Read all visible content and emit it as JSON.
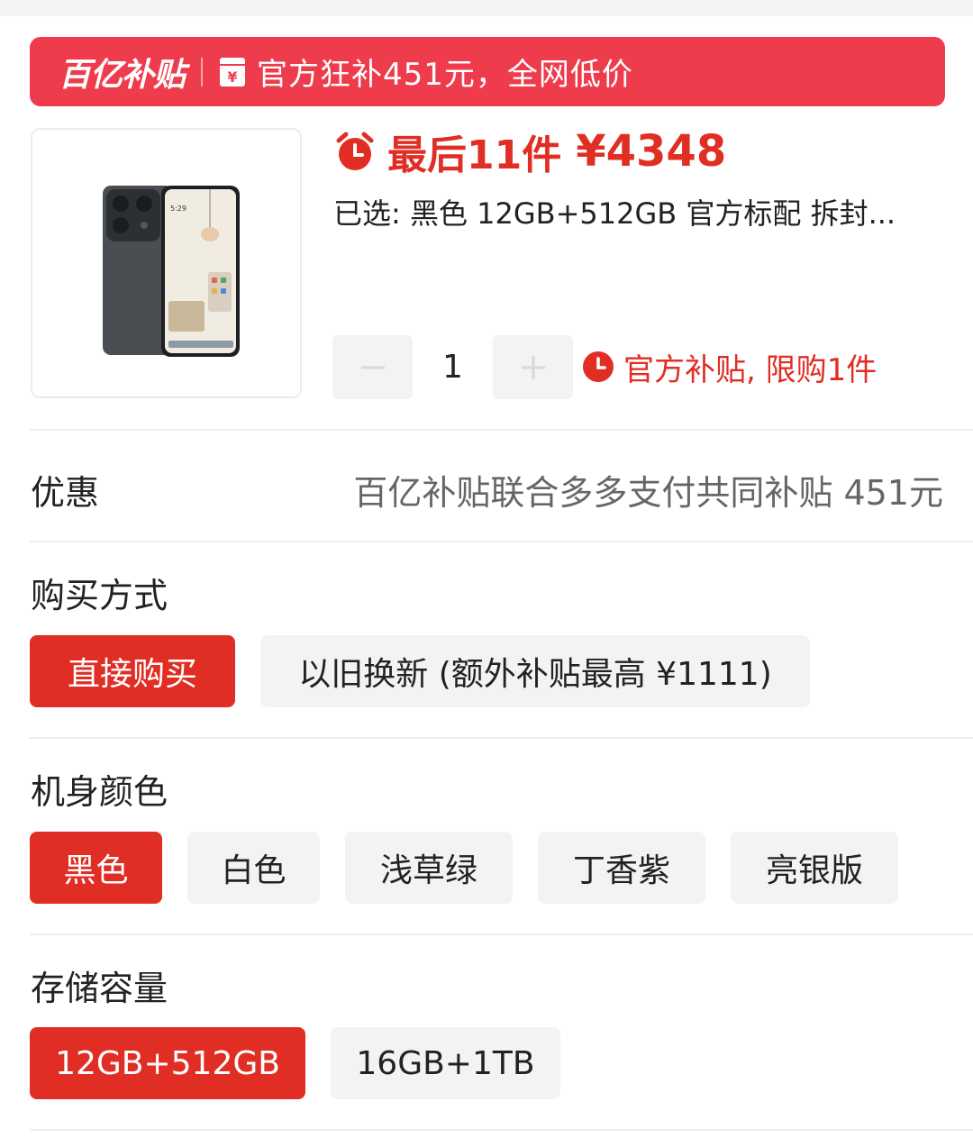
{
  "banner": {
    "brand": "百亿补贴",
    "slogan": "官方狂补451元，全网低价"
  },
  "product": {
    "stock_text": "最后11件",
    "price": "¥4348",
    "selected_text": "已选: 黑色 12GB+512GB 官方标配 拆封...",
    "quantity": "1",
    "limit_text": "官方补贴, 限购1件",
    "phone_screen_time": "5:29"
  },
  "promo": {
    "label": "优惠",
    "value": "百亿补贴联合多多支付共同补贴 451元"
  },
  "purchase_method": {
    "label": "购买方式",
    "options": [
      "直接购买",
      "以旧换新 (额外补贴最高 ¥1111)"
    ],
    "selected_index": 0
  },
  "color": {
    "label": "机身颜色",
    "options": [
      "黑色",
      "白色",
      "浅草绿",
      "丁香紫",
      "亮银版"
    ],
    "selected_index": 0
  },
  "storage": {
    "label": "存储容量",
    "options": [
      "12GB+512GB",
      "16GB+1TB"
    ],
    "selected_index": 0
  },
  "colors": {
    "accent": "#e02e24",
    "banner": "#ee3c4d",
    "chip_bg": "#f3f3f3"
  }
}
